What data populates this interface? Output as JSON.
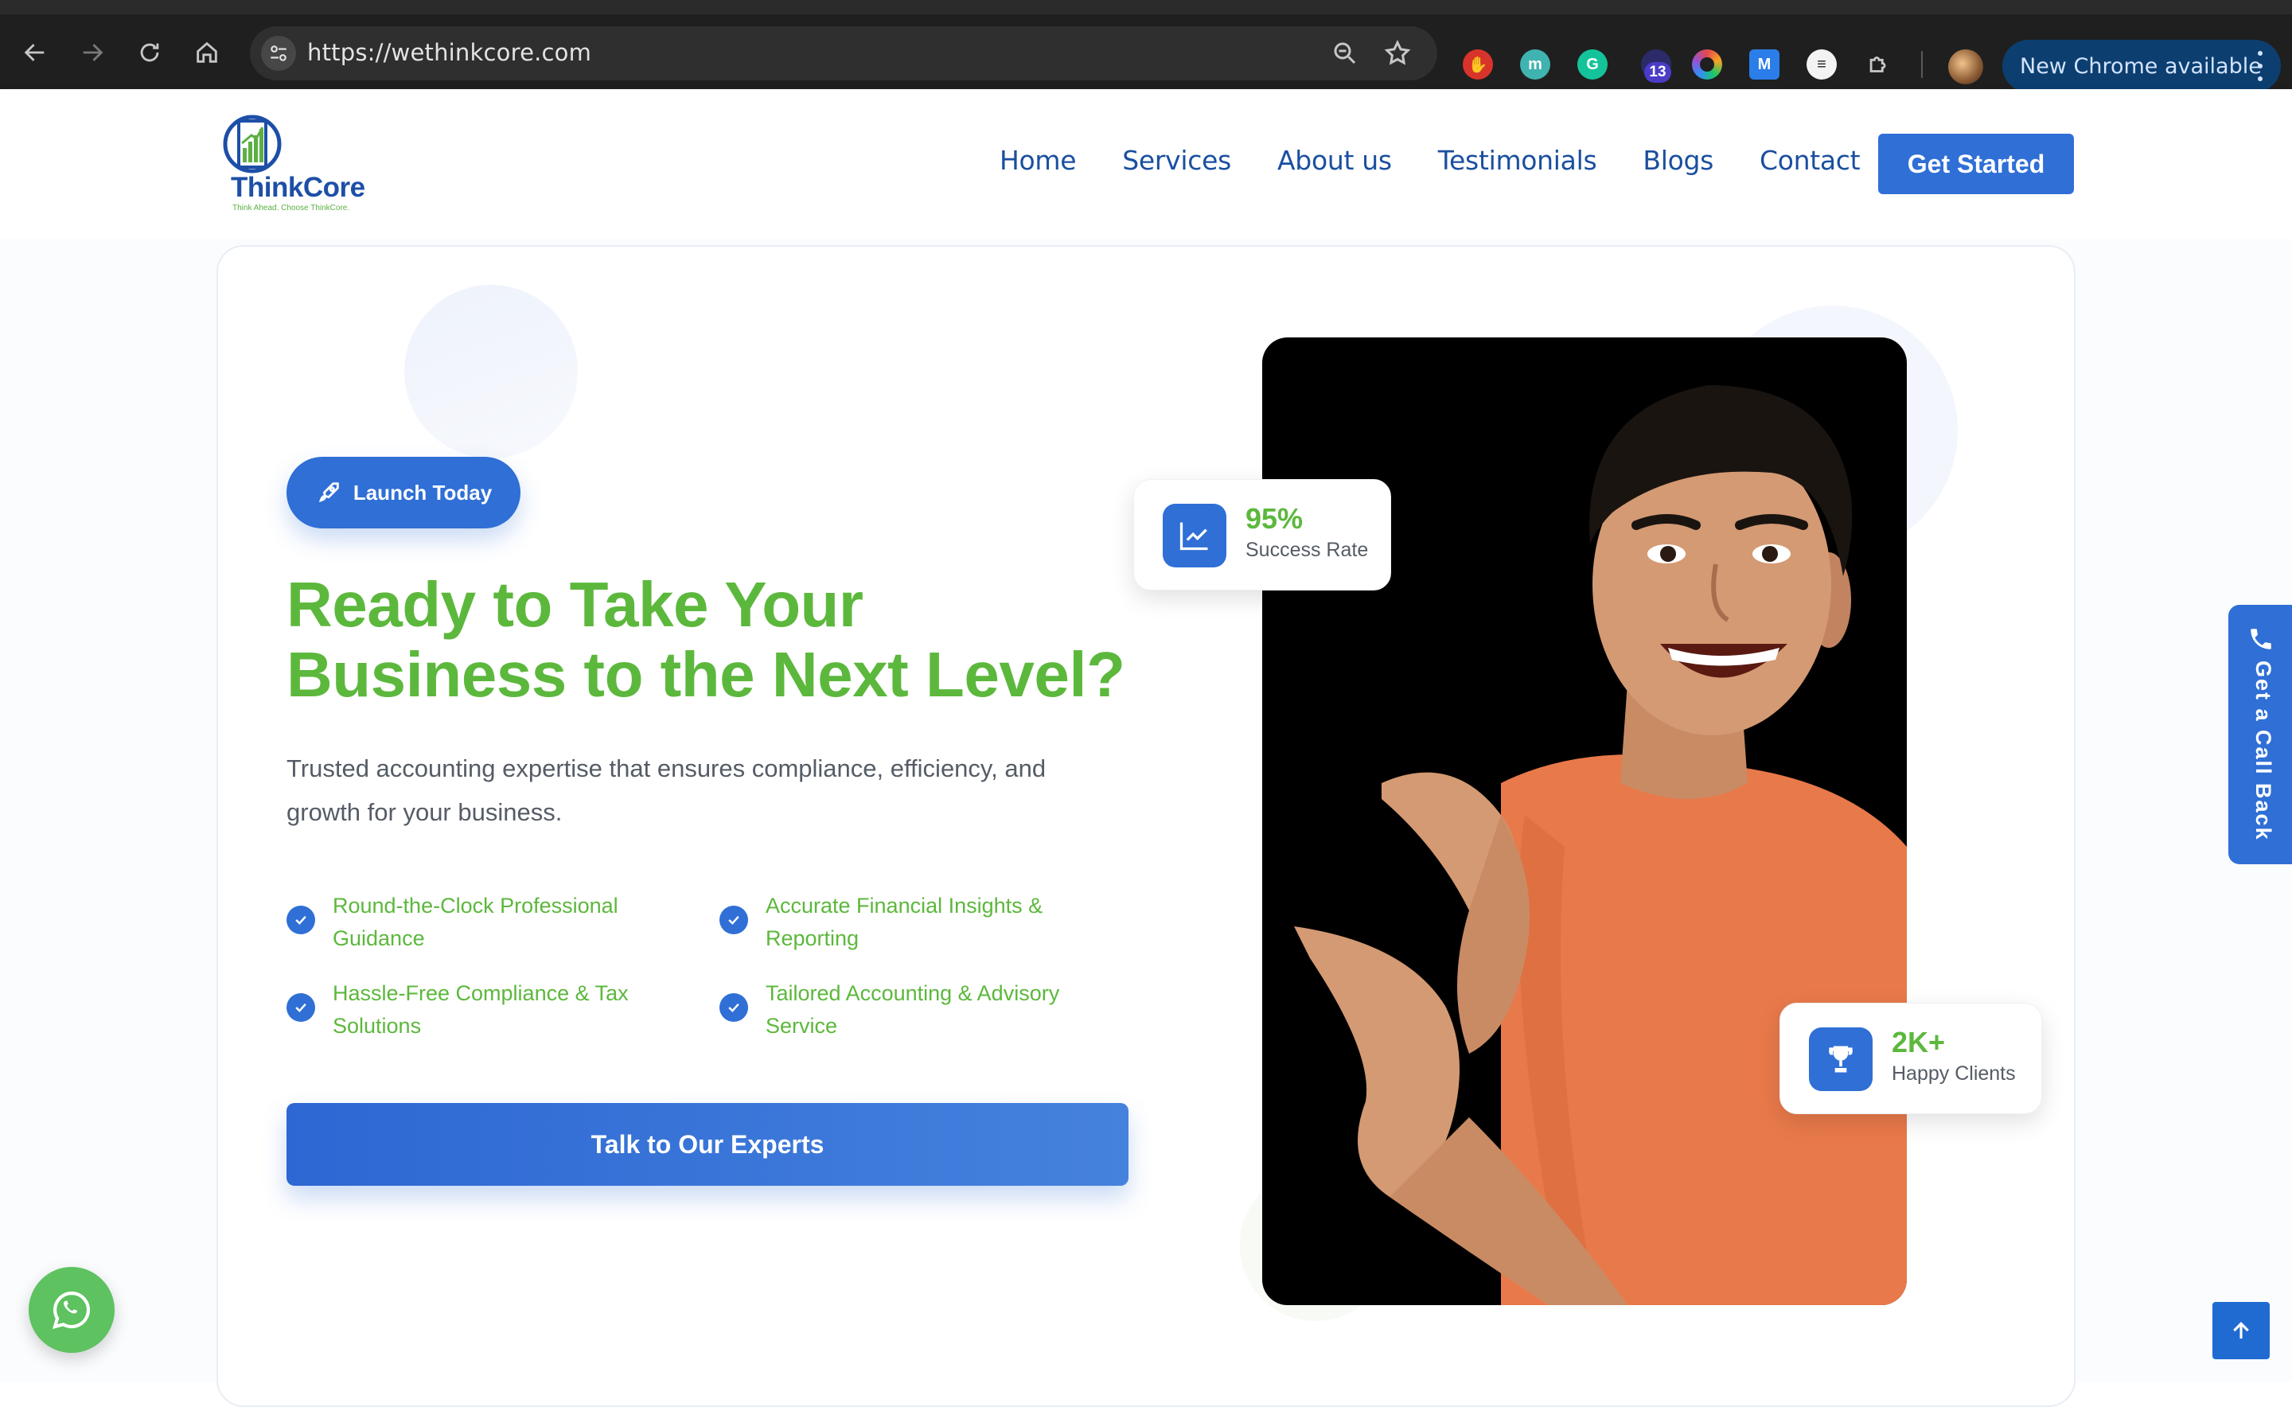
{
  "browser": {
    "url": "https://wethinkcore.com",
    "update_label": "New Chrome available",
    "extension_badge": "13",
    "extensions": [
      "adblock-icon",
      "m-extension-icon",
      "grammarly-icon",
      "extension-with-badge-icon",
      "color-picker-icon",
      "mail-extension-icon",
      "list-extension-icon",
      "puzzle-icon"
    ]
  },
  "header": {
    "logo_name": "ThinkCore",
    "logo_tagline": "Think Ahead. Choose ThinkCore.",
    "nav": [
      {
        "label": "Home"
      },
      {
        "label": "Services"
      },
      {
        "label": "About us"
      },
      {
        "label": "Testimonials"
      },
      {
        "label": "Blogs"
      },
      {
        "label": "Contact"
      }
    ],
    "cta_label": "Get Started"
  },
  "hero": {
    "badge_label": "Launch Today",
    "title_line1": "Ready to Take Your",
    "title_line2": "Business to the Next Level?",
    "subtitle_line1": "Trusted accounting expertise that ensures compliance, efficiency, and",
    "subtitle_line2": "growth for your business.",
    "features": [
      {
        "line1": "Round-the-Clock Professional",
        "line2": "Guidance"
      },
      {
        "line1": "Accurate Financial Insights &",
        "line2": "Reporting"
      },
      {
        "line1": "Hassle-Free Compliance & Tax",
        "line2": "Solutions"
      },
      {
        "line1": "Tailored Accounting & Advisory",
        "line2": "Service"
      }
    ],
    "cta_label": "Talk to Our Experts",
    "stats": [
      {
        "value": "95%",
        "label": "Success Rate",
        "icon": "trend-chart-icon"
      },
      {
        "value": "2K+",
        "label": "Happy Clients",
        "icon": "trophy-icon"
      }
    ]
  },
  "widgets": {
    "callback_label": "Get a Call Back"
  },
  "colors": {
    "brand_blue": "#2f6fd6",
    "brand_green": "#5cb83c",
    "nav_text": "#1a4fa0",
    "whatsapp_green": "#5dc25f"
  }
}
